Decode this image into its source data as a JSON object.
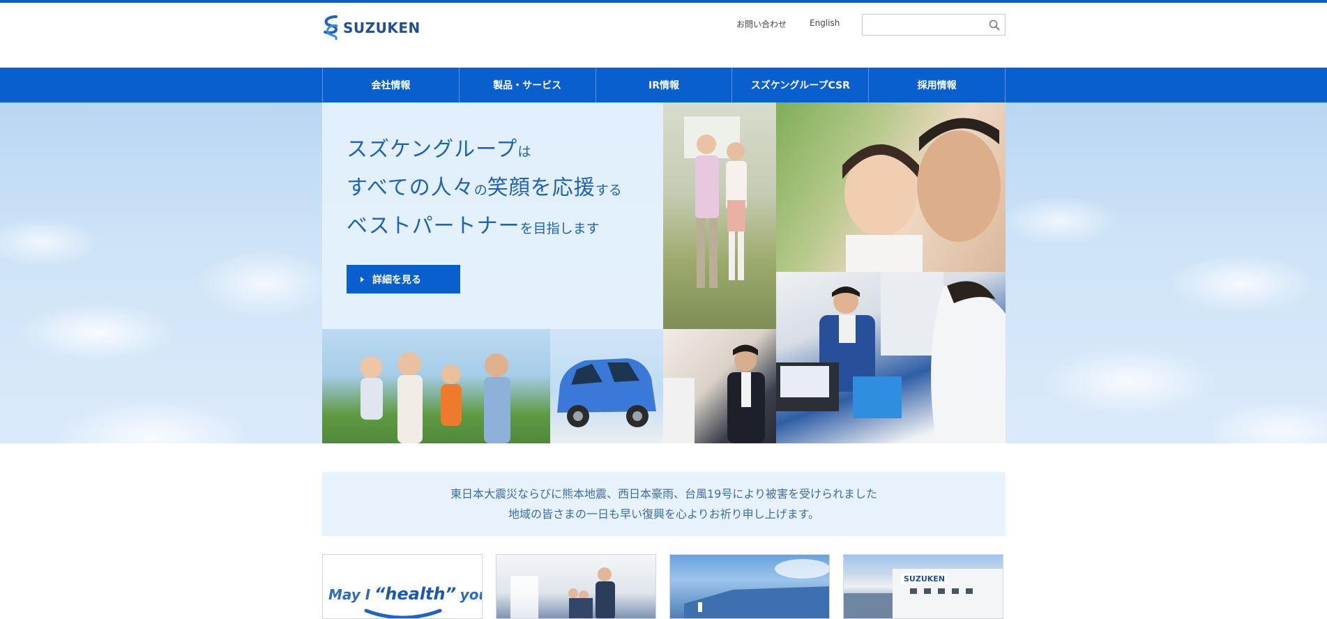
{
  "header": {
    "logo_text": "SUZUKEN",
    "links": {
      "contact": "お問い合わせ",
      "english": "English"
    },
    "search": {
      "placeholder": ""
    }
  },
  "nav": {
    "items": [
      {
        "label": "会社情報"
      },
      {
        "label": "製品・サービス"
      },
      {
        "label": "IR情報"
      },
      {
        "label": "スズケングループCSR"
      },
      {
        "label": "採用情報"
      }
    ]
  },
  "hero": {
    "line1_big": "スズケングループ",
    "line1_small": "は",
    "line2_big1": "すべての人々",
    "line2_small1": "の",
    "line2_big2": "笑顔を応援",
    "line2_small2": "する",
    "line3_big": "ベストパートナー",
    "line3_small": "を目指します",
    "button_label": "詳細を見る"
  },
  "notice": {
    "line1": "東日本大震災ならびに熊本地震、西日本豪雨、台風19号により被害を受けられました",
    "line2": "地域の皆さまの一日も早い復興を心よりお祈り申し上げます。"
  },
  "cards": {
    "card1": {
      "text_a": "May I",
      "text_b": "“health”",
      "text_c": "you?"
    },
    "card4": {
      "sign": "SUZUKEN"
    }
  },
  "colors": {
    "brand": "#0a5fcf",
    "hero_text": "#1f63b8",
    "notice_bg": "#e8f2fd"
  },
  "icons": {
    "search": "search-icon",
    "logo": "suzuken-logo-mark"
  }
}
